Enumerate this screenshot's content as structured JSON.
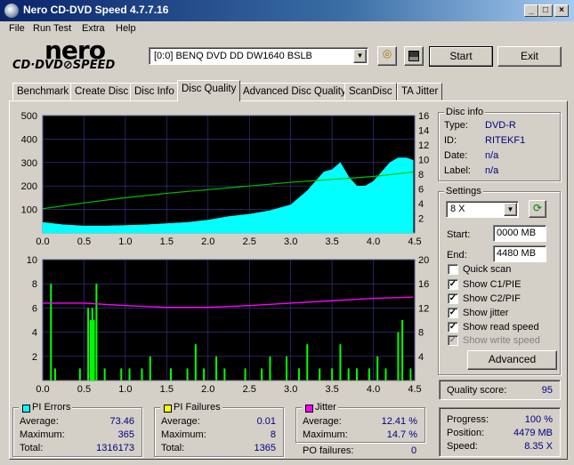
{
  "window": {
    "title": "Nero CD-DVD Speed 4.7.7.16",
    "minimize": "_",
    "maximize": "□",
    "close": "×"
  },
  "menu": [
    "File",
    "Run Test",
    "Extra",
    "Help"
  ],
  "logo": {
    "top": "nero",
    "bottom": "CD·DVD⊘SPEED"
  },
  "drive": {
    "selected": "[0:0]  BENQ DVD DD DW1640 BSLB"
  },
  "buttons": {
    "start": "Start",
    "exit": "Exit",
    "advanced": "Advanced"
  },
  "tabs": [
    "Benchmark",
    "Create Disc",
    "Disc Info",
    "Disc Quality",
    "Advanced Disc Quality",
    "ScanDisc",
    "TA Jitter"
  ],
  "active_tab": "Disc Quality",
  "disc_info": {
    "title": "Disc info",
    "type_label": "Type:",
    "type": "DVD-R",
    "id_label": "ID:",
    "id": "RITEKF1",
    "date_label": "Date:",
    "date": "n/a",
    "label_label": "Label:",
    "label": "n/a"
  },
  "settings": {
    "title": "Settings",
    "speed": "8 X",
    "start_label": "Start:",
    "start": "0000 MB",
    "end_label": "End:",
    "end": "4480 MB",
    "quick_scan": "Quick scan",
    "show_c1": "Show C1/PIE",
    "show_c2": "Show C2/PIF",
    "show_jitter": "Show jitter",
    "show_read": "Show read speed",
    "show_write": "Show write speed",
    "checks": {
      "quick_scan": false,
      "show_c1": true,
      "show_c2": true,
      "show_jitter": true,
      "show_read": true,
      "show_write": true
    }
  },
  "quality": {
    "label": "Quality score:",
    "value": "95"
  },
  "pi_errors": {
    "title": "PI Errors",
    "color": "#00ffff",
    "avg_label": "Average:",
    "avg": "73.46",
    "max_label": "Maximum:",
    "max": "365",
    "total_label": "Total:",
    "total": "1316173"
  },
  "pi_failures": {
    "title": "PI Failures",
    "color": "#ffff00",
    "avg_label": "Average:",
    "avg": "0.01",
    "max_label": "Maximum:",
    "max": "8",
    "total_label": "Total:",
    "total": "1365"
  },
  "jitter": {
    "title": "Jitter",
    "color": "#ff00ff",
    "avg_label": "Average:",
    "avg": "12.41 %",
    "max_label": "Maximum:",
    "max": "14.7 %"
  },
  "po": {
    "label": "PO failures:",
    "value": "0"
  },
  "progress": {
    "progress_label": "Progress:",
    "progress": "100 %",
    "position_label": "Position:",
    "position": "4479 MB",
    "speed_label": "Speed:",
    "speed": "8.35 X"
  },
  "chart_data": [
    {
      "type": "area",
      "title": "",
      "xlabel": "",
      "ylabel": "",
      "xlim": [
        0,
        4.5
      ],
      "ylim": [
        0,
        500
      ],
      "ylim_right": [
        0,
        16
      ],
      "xticks": [
        "0.0",
        "0.5",
        "1.0",
        "1.5",
        "2.0",
        "2.5",
        "3.0",
        "3.5",
        "4.0",
        "4.5"
      ],
      "yticks_left": [
        "100",
        "200",
        "300",
        "400",
        "500"
      ],
      "yticks_right": [
        "2",
        "4",
        "6",
        "8",
        "10",
        "12",
        "14",
        "16"
      ],
      "series": [
        {
          "color": "#00ffff",
          "x": [
            0,
            0.25,
            0.5,
            0.75,
            1.0,
            1.25,
            1.5,
            1.75,
            2.0,
            2.25,
            2.5,
            2.75,
            3.0,
            3.1,
            3.2,
            3.3,
            3.4,
            3.5,
            3.6,
            3.7,
            3.8,
            3.9,
            4.0,
            4.1,
            4.2,
            4.3,
            4.4,
            4.48
          ],
          "values": [
            45,
            35,
            30,
            30,
            32,
            35,
            40,
            45,
            55,
            70,
            80,
            95,
            120,
            150,
            180,
            220,
            260,
            270,
            300,
            240,
            200,
            200,
            220,
            260,
            300,
            320,
            320,
            310
          ]
        },
        {
          "color": "#00c000",
          "x": [
            0,
            0.5,
            1.0,
            1.5,
            2.0,
            2.5,
            3.0,
            3.5,
            4.0,
            4.48
          ],
          "values": [
            3.3,
            4.1,
            4.8,
            5.4,
            5.9,
            6.4,
            6.9,
            7.3,
            7.7,
            8.3
          ]
        }
      ]
    },
    {
      "type": "bar",
      "title": "",
      "xlabel": "",
      "ylabel": "",
      "xlim": [
        0,
        4.5
      ],
      "ylim": [
        0,
        10
      ],
      "ylim_right": [
        0,
        20
      ],
      "xticks": [
        "0.0",
        "0.5",
        "1.0",
        "1.5",
        "2.0",
        "2.5",
        "3.0",
        "3.5",
        "4.0",
        "4.5"
      ],
      "yticks_left": [
        "2",
        "4",
        "6",
        "8",
        "10"
      ],
      "yticks_right": [
        "4",
        "8",
        "12",
        "16",
        "20"
      ],
      "series": [
        {
          "color": "#00ff00",
          "x": [
            0.1,
            0.15,
            0.45,
            0.55,
            0.58,
            0.6,
            0.62,
            0.65,
            0.75,
            0.95,
            1.05,
            1.2,
            1.3,
            1.55,
            1.75,
            1.85,
            1.95,
            2.1,
            2.2,
            2.45,
            2.65,
            2.75,
            2.95,
            3.1,
            3.2,
            3.35,
            3.5,
            3.6,
            3.7,
            3.8,
            3.95,
            4.05,
            4.15,
            4.3,
            4.35,
            4.45
          ],
          "values": [
            8,
            1,
            1,
            6,
            5,
            6,
            5,
            8,
            1,
            1,
            1,
            1,
            2,
            1,
            1,
            3,
            1,
            2,
            1,
            1,
            1,
            2,
            2,
            1,
            3,
            1,
            1,
            3,
            1,
            1,
            1,
            2,
            1,
            4,
            5,
            1
          ]
        },
        {
          "color": "#ff00ff",
          "x": [
            0,
            0.5,
            1.0,
            1.5,
            2.0,
            2.5,
            3.0,
            3.5,
            4.0,
            4.48
          ],
          "values": [
            12.8,
            12.8,
            12.4,
            12.1,
            12.1,
            12.4,
            12.8,
            13.2,
            13.6,
            13.8
          ]
        }
      ]
    }
  ]
}
